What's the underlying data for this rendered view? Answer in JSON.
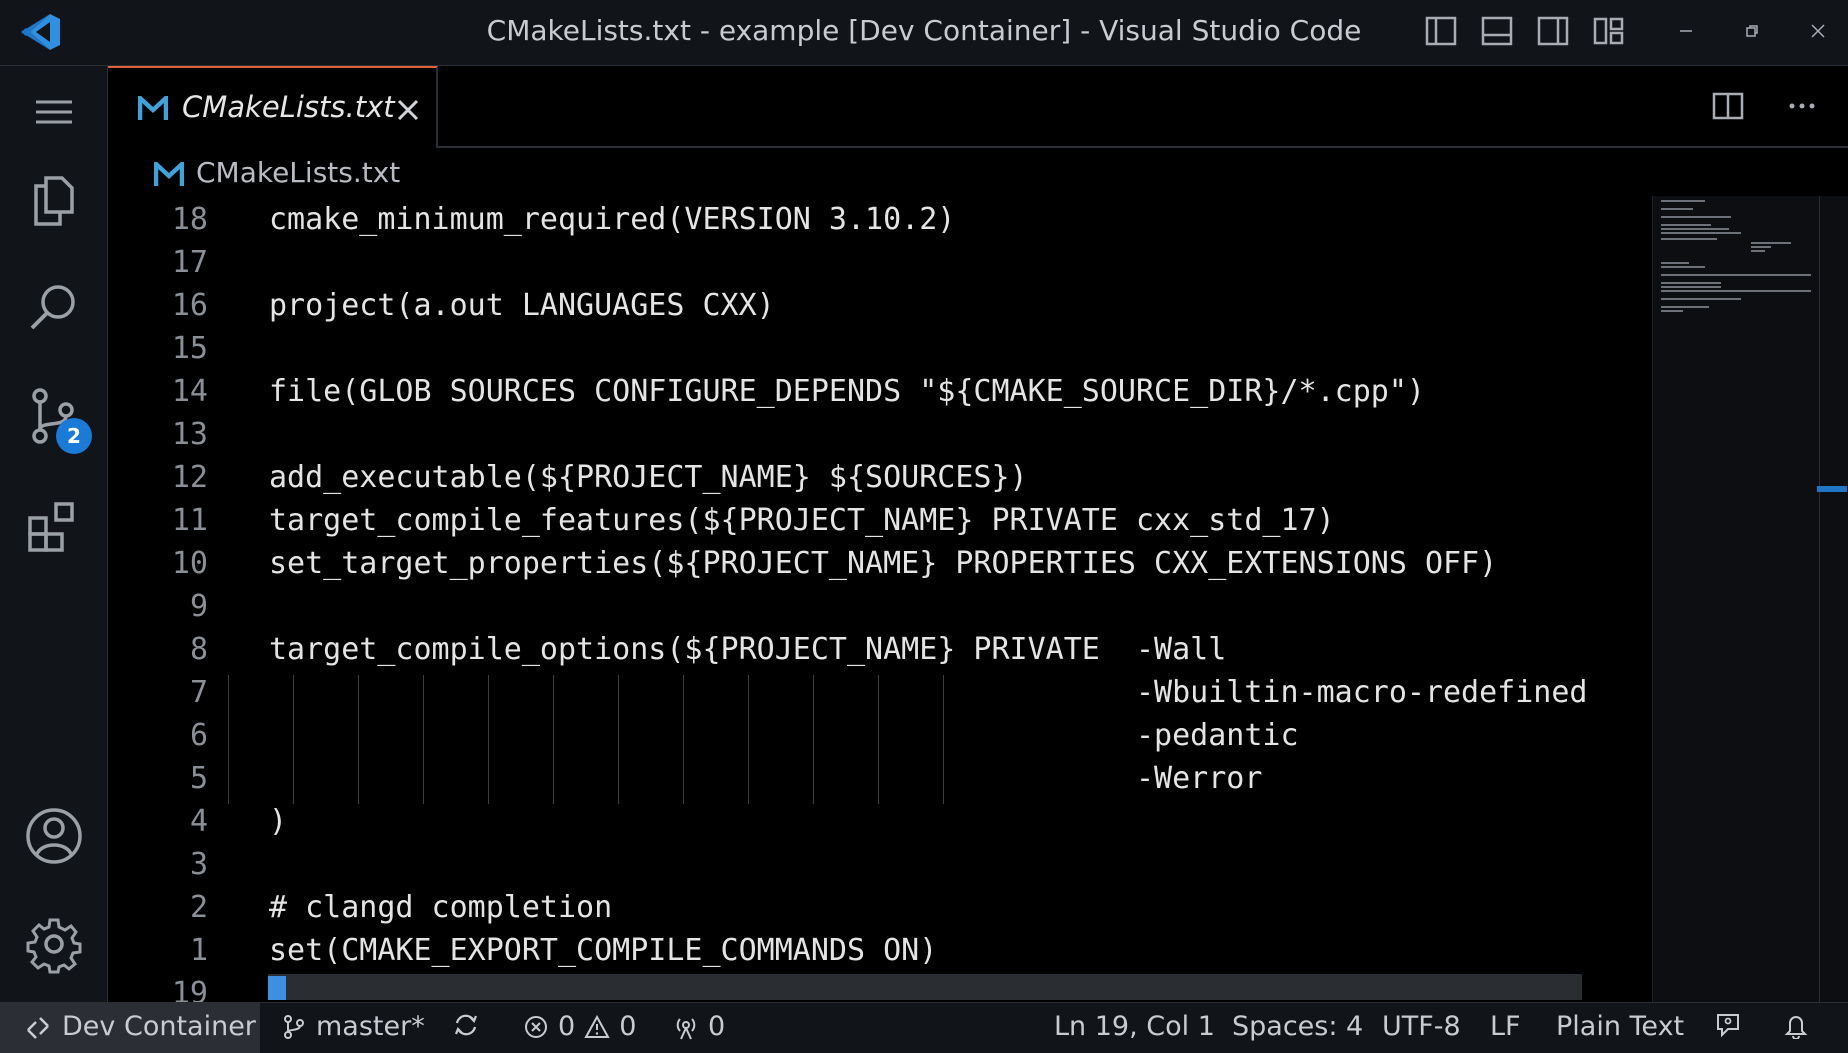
{
  "window": {
    "title": "CMakeLists.txt - example [Dev Container] - Visual Studio Code"
  },
  "activity_bar": {
    "scm_badge": "2",
    "items": [
      "menu-icon",
      "explorer-icon",
      "search-icon",
      "source-control-icon",
      "extensions-icon",
      "account-icon",
      "settings-gear-icon"
    ]
  },
  "tab": {
    "label": "CMakeLists.txt",
    "icon": "M"
  },
  "breadcrumb": {
    "icon": "M",
    "label": "CMakeLists.txt"
  },
  "editor": {
    "lines": [
      {
        "num": "18",
        "text": "cmake_minimum_required(VERSION 3.10.2)"
      },
      {
        "num": "17",
        "text": ""
      },
      {
        "num": "16",
        "text": "project(a.out LANGUAGES CXX)"
      },
      {
        "num": "15",
        "text": ""
      },
      {
        "num": "14",
        "text": "file(GLOB SOURCES CONFIGURE_DEPENDS \"${CMAKE_SOURCE_DIR}/*.cpp\")"
      },
      {
        "num": "13",
        "text": ""
      },
      {
        "num": "12",
        "text": "add_executable(${PROJECT_NAME} ${SOURCES})"
      },
      {
        "num": "11",
        "text": "target_compile_features(${PROJECT_NAME} PRIVATE cxx_std_17)"
      },
      {
        "num": "10",
        "text": "set_target_properties(${PROJECT_NAME} PROPERTIES CXX_EXTENSIONS OFF)"
      },
      {
        "num": "9",
        "text": ""
      },
      {
        "num": "8",
        "text": "target_compile_options(${PROJECT_NAME} PRIVATE  -Wall"
      },
      {
        "num": "7",
        "text": "                                                -Wbuiltin-macro-redefined"
      },
      {
        "num": "6",
        "text": "                                                -pedantic"
      },
      {
        "num": "5",
        "text": "                                                -Werror"
      },
      {
        "num": "4",
        "text": ")"
      },
      {
        "num": "3",
        "text": ""
      },
      {
        "num": "2",
        "text": "# clangd completion"
      },
      {
        "num": "1",
        "text": "set(CMAKE_EXPORT_COMPILE_COMMANDS ON)"
      },
      {
        "num": "19",
        "text": ""
      }
    ]
  },
  "status_bar": {
    "remote": "Dev Container",
    "branch": "master*",
    "errors": "0",
    "warnings": "0",
    "ports": "0",
    "position": "Ln 19, Col 1",
    "spaces": "Spaces: 4",
    "encoding": "UTF-8",
    "eol": "LF",
    "language": "Plain Text"
  },
  "colors": {
    "accent": "#1a7ad8",
    "tab_border": "#e0603a",
    "cmake_icon": "#3fa3d9"
  }
}
